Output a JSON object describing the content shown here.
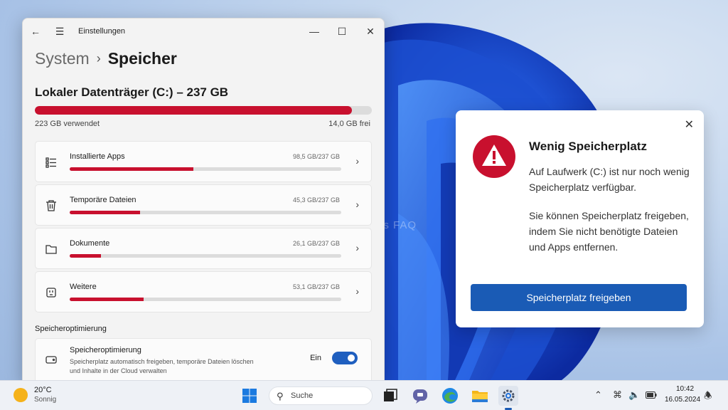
{
  "desktop": {
    "watermark": "Windows FAQ"
  },
  "window": {
    "title": "Einstellungen",
    "breadcrumb_parent": "System",
    "breadcrumb_current": "Speicher"
  },
  "drive": {
    "title": "Lokaler Datenträger (C:) – 237 GB",
    "used_label": "223 GB verwendet",
    "free_label": "14,0 GB frei",
    "used_fraction": 0.94
  },
  "categories": [
    {
      "name": "Installierte Apps",
      "size": "98,5 GB/237 GB",
      "fraction": 0.456,
      "icon": "apps-list-icon"
    },
    {
      "name": "Temporäre Dateien",
      "size": "45,3 GB/237 GB",
      "fraction": 0.259,
      "icon": "trash-icon"
    },
    {
      "name": "Dokumente",
      "size": "26,1 GB/237 GB",
      "fraction": 0.115,
      "icon": "folder-icon"
    },
    {
      "name": "Weitere",
      "size": "53,1 GB/237 GB",
      "fraction": 0.272,
      "icon": "other-icon"
    }
  ],
  "optimization": {
    "section_label": "Speicheroptimierung",
    "title": "Speicheroptimierung",
    "description": "Speicherplatz automatisch freigeben, temporäre Dateien löschen und Inhalte in der Cloud verwalten",
    "toggle_label": "Ein",
    "toggle_on": true
  },
  "notification": {
    "title": "Wenig Speicherplatz",
    "body1": "Auf Laufwerk (C:) ist nur noch wenig Speicherplatz verfügbar.",
    "body2": "Sie können Speicherplatz freigeben, indem Sie nicht benötigte Dateien und Apps entfernen.",
    "button": "Speicherplatz freigeben"
  },
  "taskbar": {
    "weather_temp": "20°C",
    "weather_desc": "Sonnig",
    "search_placeholder": "Suche",
    "time": "10:42",
    "date": "16.05.2024"
  },
  "colors": {
    "accent": "#1a5bb5",
    "warning": "#c8102e",
    "bar_fill": "#c8102e"
  }
}
